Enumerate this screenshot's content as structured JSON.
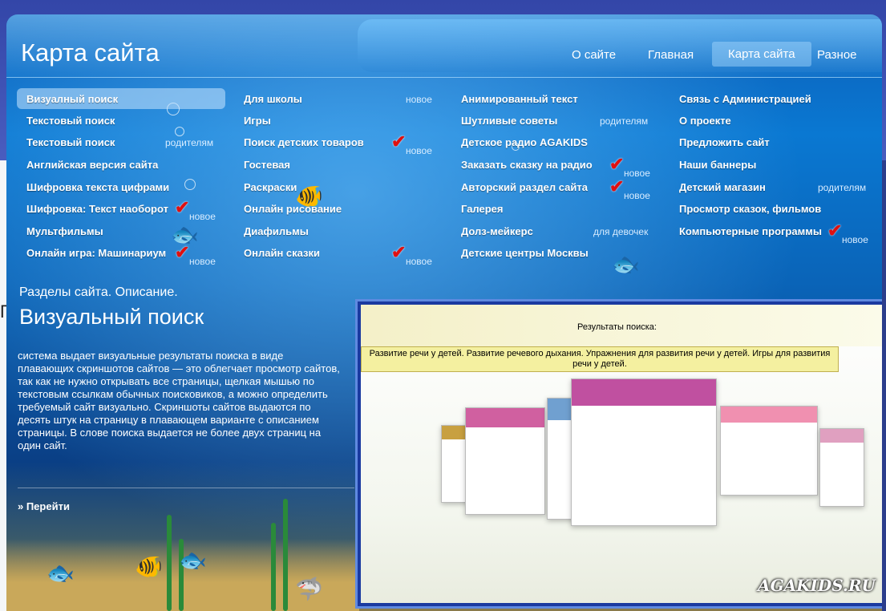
{
  "header": {
    "title": "Карта сайта",
    "nav": [
      {
        "label": "О сайте",
        "active": false
      },
      {
        "label": "Главная",
        "active": false
      },
      {
        "label": "Карта сайта",
        "active": true
      },
      {
        "label": "Разное",
        "active": false
      }
    ]
  },
  "columns": [
    {
      "items": [
        {
          "label": "Визуалный поиск",
          "tag": ""
        },
        {
          "label": "Текстовый поиск",
          "tag": ""
        },
        {
          "label": "Текстовый поиск",
          "tag": "родителям"
        },
        {
          "label": "Английская версия сайта",
          "tag": ""
        },
        {
          "label": "Шифровка текста цифрами",
          "tag": ""
        },
        {
          "label": "Шифровка: Текст наоборот",
          "tag": "новое"
        },
        {
          "label": "Мультфильмы",
          "tag": ""
        },
        {
          "label": "Онлайн игра: Машинариум",
          "tag": "новое"
        }
      ]
    },
    {
      "items": [
        {
          "label": "Для школы",
          "tag": "новое"
        },
        {
          "label": "Игры",
          "tag": ""
        },
        {
          "label": "Поиск детских товаров",
          "tag": "новое"
        },
        {
          "label": "Гостевая",
          "tag": ""
        },
        {
          "label": "Раскраски",
          "tag": ""
        },
        {
          "label": "Онлайн рисование",
          "tag": ""
        },
        {
          "label": "Диафильмы",
          "tag": ""
        },
        {
          "label": "Онлайн сказки",
          "tag": "новое"
        }
      ]
    },
    {
      "items": [
        {
          "label": "Анимированный текст",
          "tag": ""
        },
        {
          "label": "Шутливые советы",
          "tag": "родителям"
        },
        {
          "label": "Детское радио AGAKIDS",
          "tag": ""
        },
        {
          "label": "Заказать сказку на радио",
          "tag": "новое"
        },
        {
          "label": "Авторский раздел сайта",
          "tag": "новое"
        },
        {
          "label": "Галерея",
          "tag": ""
        },
        {
          "label": "Долз-мейкерс",
          "tag": "для девочек"
        },
        {
          "label": "Детские центры Москвы",
          "tag": ""
        }
      ]
    },
    {
      "items": [
        {
          "label": "Связь с Администрацией",
          "tag": ""
        },
        {
          "label": "О проекте",
          "tag": ""
        },
        {
          "label": "Предложить сайт",
          "tag": ""
        },
        {
          "label": "Наши баннеры",
          "tag": ""
        },
        {
          "label": "Детский магазин",
          "tag": "родителям"
        },
        {
          "label": "Просмотр сказок, фильмов",
          "tag": ""
        },
        {
          "label": "Компьютерные программы",
          "tag": "новое"
        }
      ]
    }
  ],
  "section": {
    "subtitle": "Разделы сайта. Описание.",
    "title": "Визуальный поиск",
    "description": "система выдает визуальные результаты поиска в виде плавающих скриншотов сайтов — это облегчает просмотр сайтов, так как не нужно открывать все страницы, щелкая мышью по текстовым ссылкам обычных поисковиков, а можно определить требуемый сайт визуально. Скриншоты сайтов выдаются по десять штук на страницу в плавающем варианте с описанием страницы. В слове поиска выдается не более двух страниц на один сайт.",
    "go_label": "» Перейти"
  },
  "preview": {
    "results_label": "Результаты поиска:",
    "query": "Развитие речи у детей. Развитие речевого дыхания. Упражнения для развития речи у детей. Игры для развития речи у детей.",
    "watermark": "AGAKIDS.RU"
  },
  "colors": {
    "accent_blue": "#0a78d2",
    "check_red": "#e01010",
    "frame_blue": "#1a3aa0"
  }
}
